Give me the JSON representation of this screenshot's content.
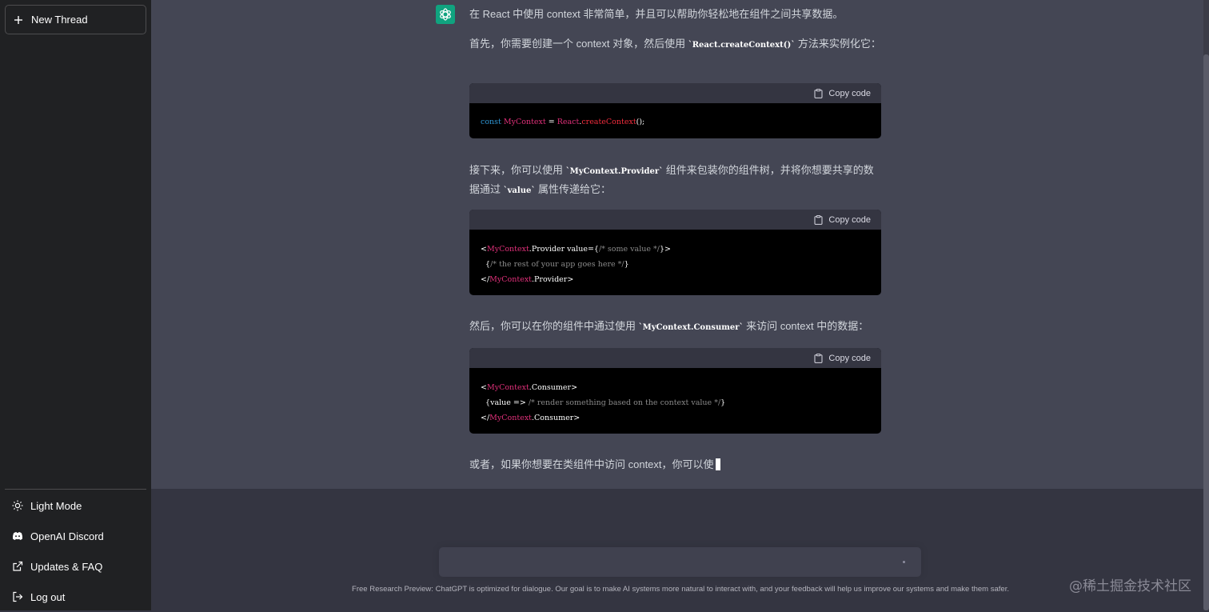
{
  "sidebar": {
    "new_thread_label": "New Thread",
    "items": [
      {
        "label": "Light Mode",
        "icon": "sun-icon"
      },
      {
        "label": "OpenAI Discord",
        "icon": "discord-icon"
      },
      {
        "label": "Updates & FAQ",
        "icon": "external-link-icon"
      },
      {
        "label": "Log out",
        "icon": "logout-icon"
      }
    ]
  },
  "message": {
    "p1": "在 React 中使用 context 非常简单，并且可以帮助你轻松地在组件之间共享数据。",
    "p2_a": "首先，你需要创建一个 context 对象，然后使用 ",
    "p2_code": "`React.createContext()`",
    "p2_b": " 方法来实例化它：",
    "p3_a": "接下来，你可以使用 ",
    "p3_code1": "`MyContext.Provider`",
    "p3_b": " 组件来包装你的组件树，并将你想要共享的数据通过 ",
    "p3_code2": "`value`",
    "p3_c": " 属性传递给它：",
    "p4_a": "然后，你可以在你的组件中通过使用 ",
    "p4_code": "`MyContext.Consumer`",
    "p4_b": " 来访问 context 中的数据：",
    "p5": "或者，如果你想要在类组件中访问 context，你可以使",
    "copy_label": "Copy code",
    "code1": {
      "kw": "const",
      "name": "MyContext",
      "eq": " = ",
      "obj": "React",
      "dot": ".",
      "fn": "createContext",
      "end": "();"
    },
    "code2": {
      "l1_open": "<",
      "l1_name": "MyContext",
      "l1_rest": ".Provider value={",
      "l1_cm": "/* some value */",
      "l1_end": "}>",
      "l2_open": "  {",
      "l2_cm": "/* the rest of your app goes here */",
      "l2_end": "}",
      "l3_open": "</",
      "l3_name": "MyContext",
      "l3_end": ".Provider>"
    },
    "code3": {
      "l1_open": "<",
      "l1_name": "MyContext",
      "l1_end": ".Consumer>",
      "l2_a": "  {value => ",
      "l2_cm": "/* render something based on the context value */",
      "l2_end": "}",
      "l3_open": "</",
      "l3_name": "MyContext",
      "l3_end": ".Consumer>"
    }
  },
  "input": {
    "placeholder": ""
  },
  "footer": {
    "text": "Free Research Preview: ChatGPT is optimized for dialogue. Our goal is to make AI systems more natural to interact with, and your feedback will help us improve our systems and make them safer."
  },
  "watermark": "@稀土掘金技术社区",
  "colors": {
    "sidebar_bg": "#202123",
    "main_bg": "#343541",
    "assistant_bg": "#444654",
    "avatar_bg": "#10a37f",
    "code_bg": "#000000"
  }
}
